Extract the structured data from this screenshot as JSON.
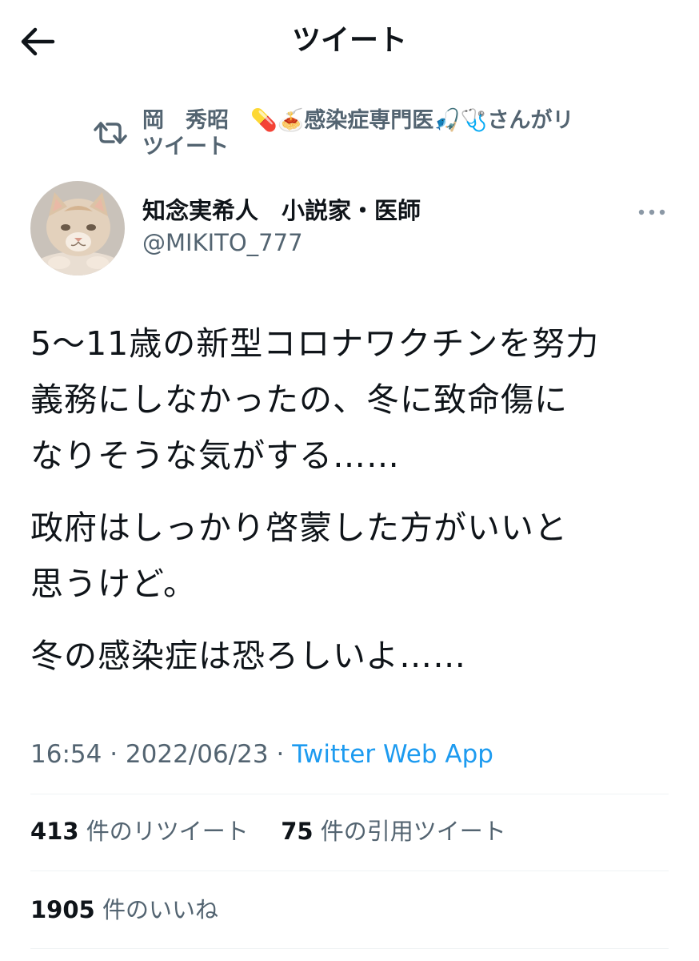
{
  "header": {
    "title": "ツイート"
  },
  "retweet_banner": {
    "line1": "岡　秀昭　💊🍝感染症専門医🎣🩺さんがリ",
    "line2": "ツイート"
  },
  "author": {
    "display_name": "知念実希人　小説家・医師",
    "handle": "@MIKITO_777"
  },
  "tweet": {
    "paragraphs": [
      [
        "5〜11歳の新型コロナワクチンを努力",
        "義務にしなかったの、冬に致命傷に",
        "なりそうな気がする……"
      ],
      [
        "政府はしっかり啓蒙した方がいいと",
        "思うけど。"
      ],
      [
        "冬の感染症は恐ろしいよ……"
      ]
    ]
  },
  "meta": {
    "time": "16:54",
    "separator": "·",
    "date": "2022/06/23",
    "source": "Twitter Web App"
  },
  "stats": {
    "retweets_count": "413",
    "retweets_label": "件のリツイート",
    "quotes_count": "75",
    "quotes_label": "件の引用ツイート",
    "likes_count": "1905",
    "likes_label": "件のいいね"
  },
  "colors": {
    "text_primary": "#0f1419",
    "text_secondary": "#536471",
    "link_blue": "#1d9bf0",
    "divider": "#eff3f4"
  },
  "icons": {
    "back": "arrow-left-icon",
    "retweet": "retweet-icon",
    "more": "more-horizontal-icon"
  }
}
